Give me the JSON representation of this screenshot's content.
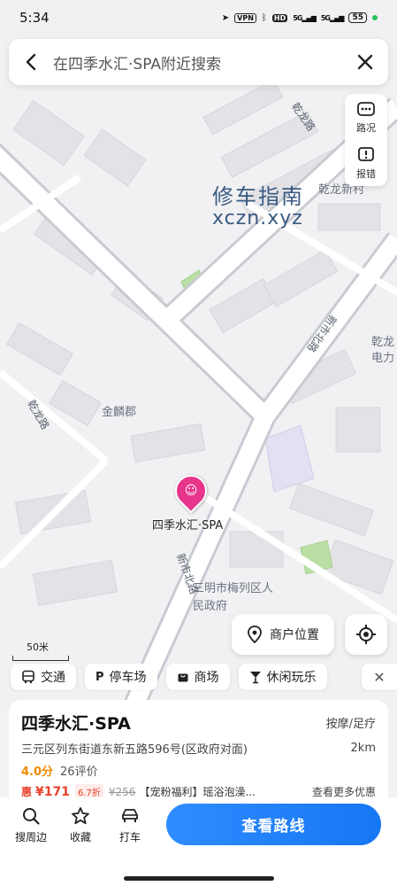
{
  "status_bar": {
    "time": "5:34",
    "vpn": "VPN",
    "hd": "HD",
    "signal1": "5G",
    "signal2": "5G",
    "battery": "55"
  },
  "search": {
    "text": "在四季水汇·SPA附近搜索"
  },
  "map_controls": {
    "traffic_label": "路况",
    "report_label": "报错",
    "merchant_location_label": "商户位置",
    "scale_label": "50米"
  },
  "map": {
    "labels": {
      "qianlong_road_top": "乾龙路",
      "qianlong_xincun": "乾龙新村",
      "qianlong_power": "乾龙电力",
      "xinshi_north_road_top": "新市北路",
      "qianlong_road_left": "乾龙路",
      "jinlin_jun": "金麟郡",
      "xinshi_north_road_bottom": "新市北路",
      "sanming_gov": "三明市梅列区人民政府",
      "poi_name": "四季水汇·SPA"
    },
    "watermark": {
      "line1": "修车指南",
      "line2": "xczn.xyz"
    }
  },
  "chips": [
    {
      "icon": "bus-icon",
      "label": "交通"
    },
    {
      "icon": "parking-icon",
      "label": "停车场"
    },
    {
      "icon": "shopping-bag-icon",
      "label": "商场"
    },
    {
      "icon": "cocktail-icon",
      "label": "休闲玩乐"
    }
  ],
  "card": {
    "title": "四季水汇·SPA",
    "category": "按摩/足疗",
    "address": "三元区列东街道东新五路596号(区政府对面)",
    "distance": "2km",
    "score": "4.0分",
    "reviews": "26评价",
    "deal": {
      "tag": "惠",
      "price": "¥171",
      "discount": "6.7折",
      "original": "¥256",
      "description": "【宠粉福利】瑶浴泡澡...",
      "more": "查看更多优惠"
    }
  },
  "bottom_bar": {
    "search_nearby": "搜周边",
    "favorite": "收藏",
    "taxi": "打车",
    "route": "查看路线"
  },
  "colors": {
    "accent": "#1677f5",
    "poi_pin": "#e7358c",
    "price": "#e8432e",
    "score": "#f08a00"
  }
}
